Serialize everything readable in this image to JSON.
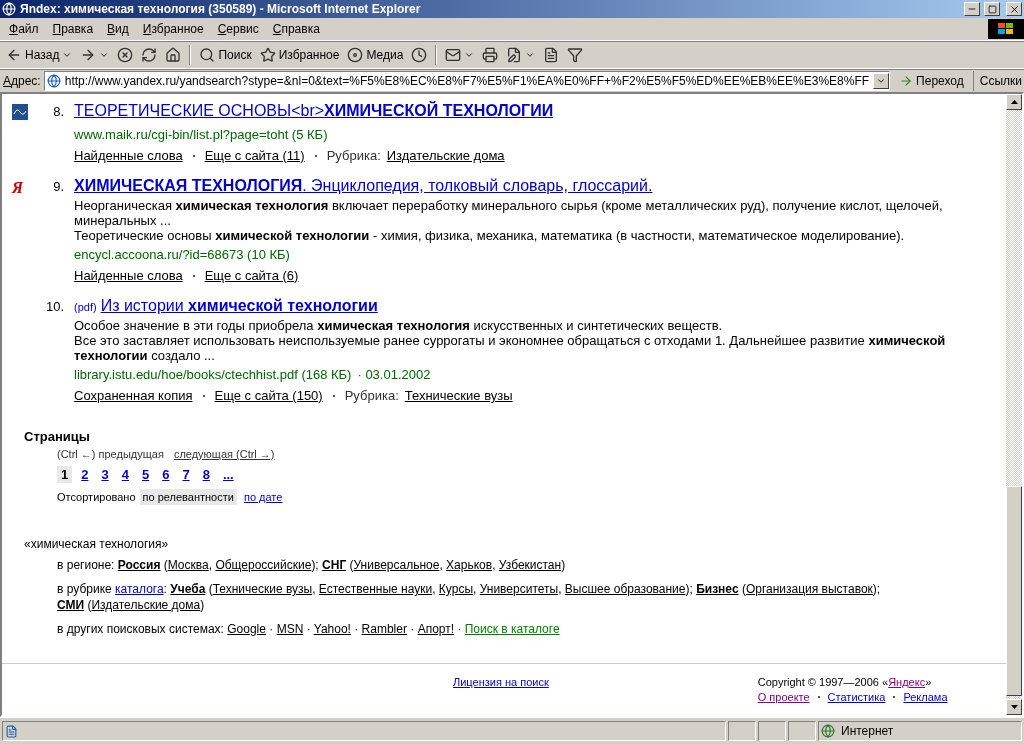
{
  "window": {
    "title": "Яndex: химическая технология (350589) - Microsoft Internet Explorer"
  },
  "menu": [
    "Файл",
    "Правка",
    "Вид",
    "Избранное",
    "Сервис",
    "Справка"
  ],
  "toolbar": [
    {
      "kind": "back",
      "label": "Назад",
      "dropdown": true
    },
    {
      "kind": "forward",
      "dropdown": true
    },
    {
      "kind": "stop",
      "dropdown": false
    },
    {
      "kind": "refresh",
      "dropdown": false
    },
    {
      "kind": "home",
      "dropdown": false
    },
    {
      "kind": "separator"
    },
    {
      "kind": "search",
      "label": "Поиск",
      "dropdown": false
    },
    {
      "kind": "favorites",
      "label": "Избранное",
      "dropdown": false
    },
    {
      "kind": "media",
      "label": "Медиа",
      "dropdown": false
    },
    {
      "kind": "history",
      "dropdown": false
    },
    {
      "kind": "separator"
    },
    {
      "kind": "mail",
      "dropdown": true
    },
    {
      "kind": "print",
      "dropdown": false
    },
    {
      "kind": "edit",
      "dropdown": true
    },
    {
      "kind": "discuss",
      "dropdown": false
    },
    {
      "kind": "research",
      "dropdown": false
    }
  ],
  "address": {
    "label": "Адрес:",
    "url": "http://www.yandex.ru/yandsearch?stype=&nl=0&text=%F5%E8%EC%E8%F7%E5%F1%EA%E0%FF+%F2%E5%F5%ED%EE%EB%EE%E3%E8%FF",
    "go": "Переход",
    "links": "Ссылки"
  },
  "results": [
    {
      "number": "8.",
      "marker": {
        "kind": "site-icon"
      },
      "title": "ТЕОРЕТИЧЕСКИЕ ОСНОВЫ<br>**ХИМИЧЕСКОЙ ТЕХНОЛОГИИ**",
      "url": "www.maik.ru/cgi-bin/list.pl?page=toht (5 КБ)",
      "links": [
        {
          "text": "Найденные слова"
        },
        {
          "text": "Еще с сайта (11)"
        },
        {
          "label": "Рубрика:",
          "text": "Издательские дома"
        }
      ]
    },
    {
      "number": "9.",
      "marker": {
        "kind": "letter",
        "text": "Я"
      },
      "title": "**ХИМИЧЕСКАЯ ТЕХНОЛОГИЯ**. Энциклопедия, толковый словарь, глоссарий.",
      "snippets": [
        "Неорганическая **химическая технология** включает переработку минерального сырья (кроме металлических руд), получение кислот, щелочей, минеральных ...",
        "Теоретические основы **химической технологии** - химия, физика, механика, математика (в частности, математическое моделирование)."
      ],
      "url": "encycl.accoona.ru/?id=68673 (10 КБ)",
      "links": [
        {
          "text": "Найденные слова"
        },
        {
          "text": "Еще с сайта (6)"
        }
      ]
    },
    {
      "number": "10.",
      "tag": "(pdf)",
      "title": "Из истории **химической технологии**",
      "snippets": [
        "Особое значение в эти годы приобрела **химическая технология** искусственных и синтетических веществ.",
        "Все это заставляет использовать неиспользуемые ранее суррогаты и экономнее обращаться с отходами 1. Дальнейшее развитие **химической технологии** создало ..."
      ],
      "url": "library.istu.edu/hoe/books/ctechhist.pdf (168 КБ)",
      "date": "· 03.01.2002",
      "links": [
        {
          "text": "Сохраненная копия"
        },
        {
          "text": "Еще с сайта (150)"
        },
        {
          "label": "Рубрика:",
          "text": "Технические вузы"
        }
      ]
    }
  ],
  "pages": {
    "heading": "Страницы",
    "prev": "(Ctrl ←) предыдущая",
    "next": "следующая (Ctrl →)",
    "items": [
      {
        "label": "1",
        "selected": true
      },
      {
        "label": "2",
        "selected": false
      },
      {
        "label": "3",
        "selected": false
      },
      {
        "label": "4",
        "selected": false
      },
      {
        "label": "5",
        "selected": false
      },
      {
        "label": "6",
        "selected": false
      },
      {
        "label": "7",
        "selected": false
      },
      {
        "label": "8",
        "selected": false
      },
      {
        "label": "...",
        "selected": false
      }
    ],
    "sort_label": "Отсортировано",
    "sort": [
      {
        "label": "по релевантности",
        "selected": true
      },
      {
        "label": "по дате",
        "selected": false
      }
    ]
  },
  "related": {
    "query": "«химическая технология»",
    "lines": [
      [
        {
          "kind": "plain",
          "text": "в регионе: "
        },
        {
          "kind": "bold",
          "text": "Россия"
        },
        {
          "kind": "plain",
          "text": " ("
        },
        {
          "kind": "link",
          "text": "Москва"
        },
        {
          "kind": "plain",
          "text": ", "
        },
        {
          "kind": "link",
          "text": "Общероссийские"
        },
        {
          "kind": "plain",
          "text": "); "
        },
        {
          "kind": "bold",
          "text": "СНГ"
        },
        {
          "kind": "plain",
          "text": " ("
        },
        {
          "kind": "link",
          "text": "Универсальное"
        },
        {
          "kind": "plain",
          "text": ", "
        },
        {
          "kind": "link",
          "text": "Харьков"
        },
        {
          "kind": "plain",
          "text": ", "
        },
        {
          "kind": "link",
          "text": "Узбекистан"
        },
        {
          "kind": "plain",
          "text": ")"
        }
      ],
      [
        {
          "kind": "plain",
          "text": "в рубрике "
        },
        {
          "kind": "blue",
          "text": "каталога"
        },
        {
          "kind": "plain",
          "text": ": "
        },
        {
          "kind": "bold",
          "text": "Учеба"
        },
        {
          "kind": "plain",
          "text": " ("
        },
        {
          "kind": "link",
          "text": "Технические вузы"
        },
        {
          "kind": "plain",
          "text": ", "
        },
        {
          "kind": "link",
          "text": "Естественные науки"
        },
        {
          "kind": "plain",
          "text": ", "
        },
        {
          "kind": "link",
          "text": "Курсы"
        },
        {
          "kind": "plain",
          "text": ", "
        },
        {
          "kind": "link",
          "text": "Университеты"
        },
        {
          "kind": "plain",
          "text": ", "
        },
        {
          "kind": "link",
          "text": "Высшее образование"
        },
        {
          "kind": "plain",
          "text": "); "
        },
        {
          "kind": "bold",
          "text": "Бизнес"
        },
        {
          "kind": "plain",
          "text": " ("
        },
        {
          "kind": "link",
          "text": "Организация выставок"
        },
        {
          "kind": "plain",
          "text": "); "
        },
        {
          "kind": "bold",
          "text": "СМИ"
        },
        {
          "kind": "plain",
          "text": " ("
        },
        {
          "kind": "link",
          "text": "Издательские дома"
        },
        {
          "kind": "plain",
          "text": ")"
        }
      ],
      [
        {
          "kind": "plain",
          "text": "в других поисковых системах: "
        },
        {
          "kind": "link",
          "text": "Google"
        },
        {
          "kind": "plain",
          "text": " · "
        },
        {
          "kind": "link",
          "text": "MSN"
        },
        {
          "kind": "plain",
          "text": " · "
        },
        {
          "kind": "link",
          "text": "Yahoo!"
        },
        {
          "kind": "plain",
          "text": " · "
        },
        {
          "kind": "link",
          "text": "Rambler"
        },
        {
          "kind": "plain",
          "text": " · "
        },
        {
          "kind": "link",
          "text": "Апорт!"
        },
        {
          "kind": "plain",
          "text": " · "
        },
        {
          "kind": "green",
          "text": "Поиск в каталоге"
        }
      ]
    ]
  },
  "footer": {
    "license": "Лицензия на поиск",
    "copyright_before": "Copyright © 1997—2006 «",
    "copyright_link": "Яндекс",
    "copyright_after": "»",
    "links": [
      {
        "text": "О проекте",
        "visited": true
      },
      {
        "text": "Статистика",
        "visited": false
      },
      {
        "text": "Реклама",
        "visited": false
      }
    ]
  },
  "status_bar": {
    "zone": "Интернет"
  }
}
